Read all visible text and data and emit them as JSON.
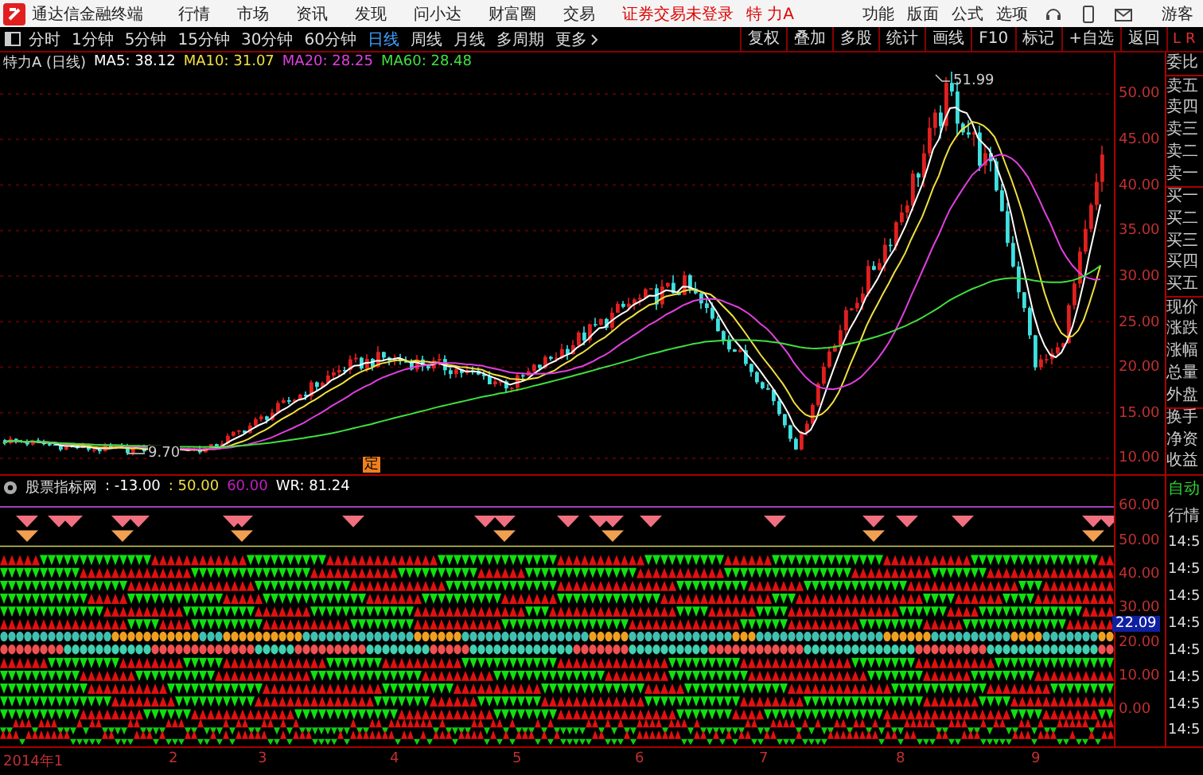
{
  "menu_bar": {
    "app_name": "通达信金融终端",
    "menus": [
      "行情",
      "市场",
      "资讯",
      "发现",
      "问小达",
      "财富圈",
      "交易"
    ],
    "login_status": "证券交易未登录",
    "stock_name": "特 力A",
    "tools": [
      "功能",
      "版面",
      "公式",
      "选项"
    ],
    "user": "游客"
  },
  "period_bar": {
    "periods": [
      {
        "label": "分时",
        "selected": false
      },
      {
        "label": "1分钟",
        "selected": false
      },
      {
        "label": "5分钟",
        "selected": false
      },
      {
        "label": "15分钟",
        "selected": false
      },
      {
        "label": "30分钟",
        "selected": false
      },
      {
        "label": "60分钟",
        "selected": false
      },
      {
        "label": "日线",
        "selected": true
      },
      {
        "label": "周线",
        "selected": false
      },
      {
        "label": "月线",
        "selected": false
      },
      {
        "label": "多周期",
        "selected": false
      }
    ],
    "more": "更多",
    "buttons": [
      "复权",
      "叠加",
      "多股",
      "统计",
      "画线",
      "F10",
      "标记",
      "+自选",
      "返回"
    ],
    "corner_labels": [
      "L",
      "R"
    ]
  },
  "main_chart": {
    "title": "特力A (日线)",
    "averages": [
      {
        "label": "MA5: 38.12",
        "color": "#ffffff"
      },
      {
        "label": "MA10: 31.07",
        "color": "#f0e040"
      },
      {
        "label": "MA20: 28.25",
        "color": "#e040e0"
      },
      {
        "label": "MA60: 28.48",
        "color": "#40e040"
      }
    ],
    "high_label": "51.99",
    "low_label": "9.70",
    "marker": "定",
    "price_ticks": [
      "50.00",
      "45.00",
      "40.00",
      "35.00",
      "30.00",
      "25.00",
      "20.00",
      "15.00",
      "10.00"
    ]
  },
  "quote_panel": {
    "labels": [
      "委比",
      "卖五",
      "卖四",
      "卖三",
      "卖二",
      "卖一",
      "买一",
      "买二",
      "买三",
      "买四",
      "买五",
      "现价",
      "涨跌",
      "涨幅",
      "总量",
      "外盘",
      "换手",
      "净资",
      "收益"
    ]
  },
  "indicator_panel": {
    "title": "股票指标网",
    "values": [
      {
        "label": ": -13.00",
        "color": "#ffffff"
      },
      {
        "label": ": 50.00",
        "color": "#f0e040"
      },
      {
        "label": "60.00",
        "color": "#c020c0"
      },
      {
        "label": "WR: 81.24",
        "color": "#ffffff"
      }
    ],
    "ticks": [
      "60.00",
      "50.00",
      "40.00",
      "30.00",
      "20.00",
      "10.00",
      "0.00"
    ],
    "current": "22.09"
  },
  "trade_panel": {
    "mode": "自动",
    "title": "行情",
    "times": [
      "14:5",
      "14:5",
      "14:5",
      "14:5",
      "14:5",
      "14:5",
      "14:5",
      "14:5"
    ]
  },
  "date_axis": [
    "2014年1",
    "2",
    "3",
    "4",
    "5",
    "6",
    "7",
    "8",
    "9"
  ]
}
